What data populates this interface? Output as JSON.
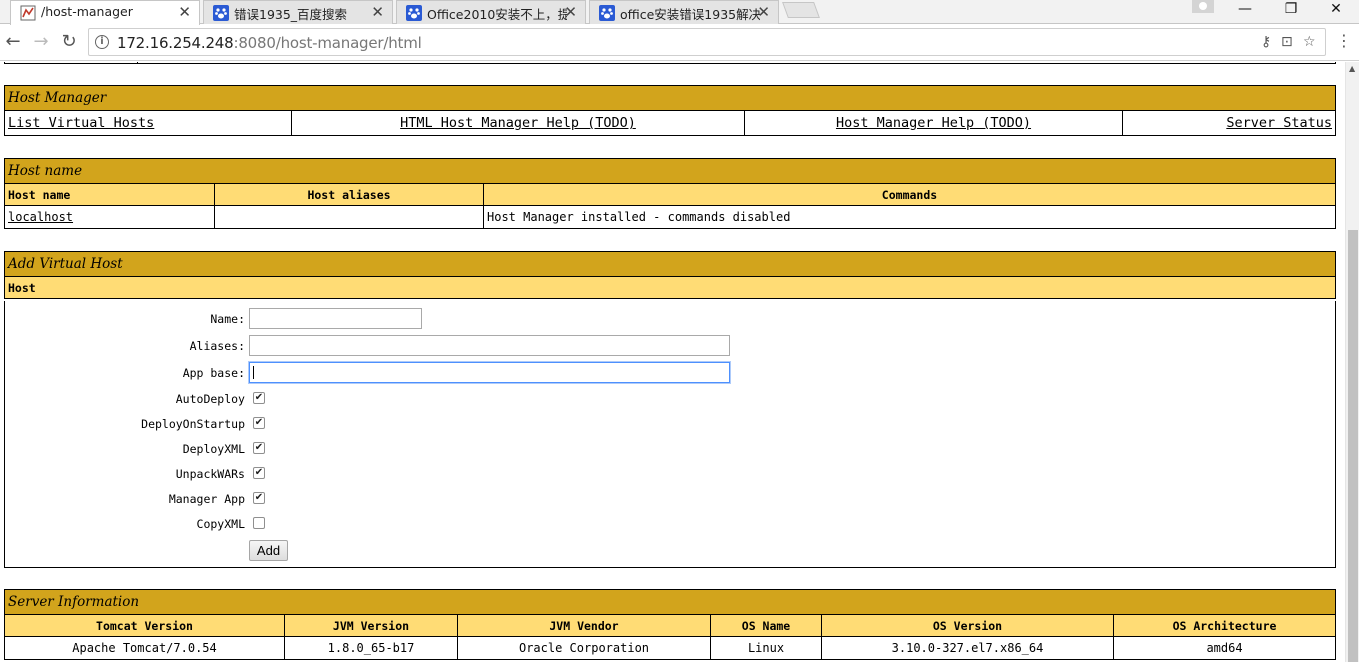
{
  "browser": {
    "tabs": [
      {
        "title": "/host-manager",
        "active": true
      },
      {
        "title": "错误1935_百度搜索",
        "active": false
      },
      {
        "title": "Office2010安装不上，提",
        "active": false
      },
      {
        "title": "office安装错误1935解决",
        "active": false
      }
    ],
    "url_host": "172.16.254.248",
    "url_rest": ":8080/host-manager/html",
    "window_controls": {
      "minimize": "—",
      "restore": "❐",
      "close": "✕"
    }
  },
  "nav_section": {
    "title": "Host Manager",
    "links": [
      "List Virtual Hosts",
      "HTML Host Manager Help (TODO)",
      "Host Manager Help (TODO)",
      "Server Status"
    ]
  },
  "hosts_section": {
    "title": "Host name",
    "headers": [
      "Host name",
      "Host aliases",
      "Commands"
    ],
    "rows": [
      {
        "host": "localhost",
        "aliases": "",
        "commands": "Host Manager installed - commands disabled"
      }
    ]
  },
  "add_section": {
    "title": "Add Virtual Host",
    "subheader": "Host",
    "fields": {
      "name_label": "Name:",
      "name_value": "",
      "aliases_label": "Aliases:",
      "aliases_value": "",
      "appbase_label": "App base:",
      "appbase_value": ""
    },
    "checkboxes": [
      {
        "label": "AutoDeploy",
        "checked": true
      },
      {
        "label": "DeployOnStartup",
        "checked": true
      },
      {
        "label": "DeployXML",
        "checked": true
      },
      {
        "label": "UnpackWARs",
        "checked": true
      },
      {
        "label": "Manager App",
        "checked": true
      },
      {
        "label": "CopyXML",
        "checked": false
      }
    ],
    "add_button": "Add"
  },
  "server_info": {
    "title": "Server Information",
    "headers": [
      "Tomcat Version",
      "JVM Version",
      "JVM Vendor",
      "OS Name",
      "OS Version",
      "OS Architecture"
    ],
    "values": [
      "Apache Tomcat/7.0.54",
      "1.8.0_65-b17",
      "Oracle Corporation",
      "Linux",
      "3.10.0-327.el7.x86_64",
      "amd64"
    ]
  },
  "colors": {
    "title_bar": "#d2a41c",
    "header_bar": "#ffdc75",
    "tab_icon_blue": "#2a5ad4"
  }
}
